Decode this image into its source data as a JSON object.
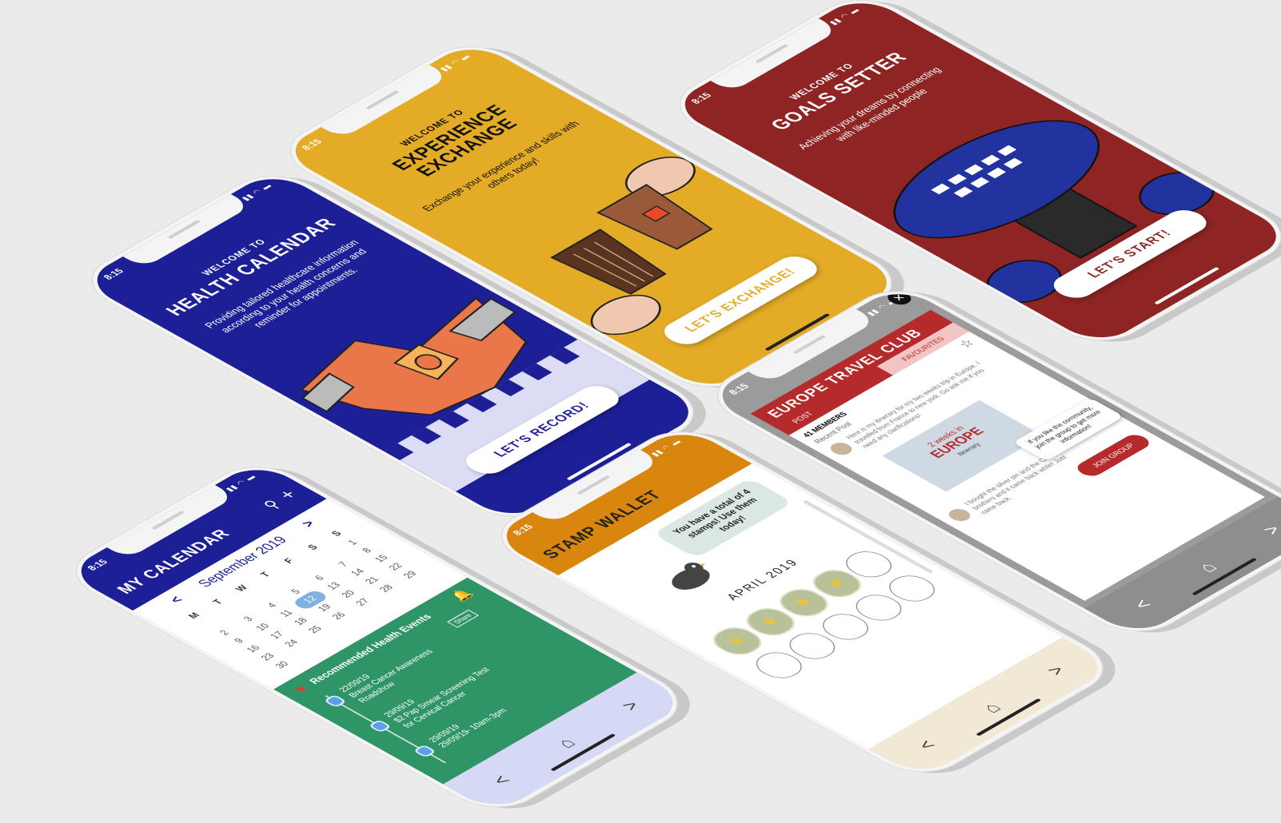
{
  "status": {
    "time": "8:15",
    "icons": "▮▮ ◠ ▬"
  },
  "phones": {
    "health": {
      "welcome_small": "WELCOME TO",
      "welcome_big": "HEALTH CALENDAR",
      "subtitle": "Providing tailored healthcare information according to your health concerns and reminder for appointments.",
      "cta": "LET'S RECORD!",
      "bg": "#1c1f96"
    },
    "experience": {
      "welcome_small": "WELCOME TO",
      "welcome_big_1": "EXPERIENCE",
      "welcome_big_2": "EXCHANGE",
      "subtitle": "Exchange your experience and skills with others today!",
      "cta": "LET'S EXCHANGE!",
      "bg": "#e3ab26"
    },
    "goals": {
      "welcome_small": "WELCOME TO",
      "welcome_big": "GOALS SETTER",
      "subtitle": "Achieving your dreams by connecting with like-minded people",
      "cta": "LET'S START!",
      "bg": "#8e2424"
    },
    "calendar": {
      "title": "MY CALENDAR",
      "month": "September 2019",
      "weekdays": [
        "M",
        "T",
        "W",
        "T",
        "F",
        "S",
        "S"
      ],
      "days": [
        "",
        "",
        "",
        "",
        "",
        "",
        "1",
        "2",
        "3",
        "4",
        "5",
        "6",
        "7",
        "8",
        "9",
        "10",
        "11",
        "12",
        "13",
        "14",
        "15",
        "16",
        "17",
        "18",
        "19",
        "20",
        "21",
        "22",
        "23",
        "24",
        "25",
        "26",
        "27",
        "28",
        "29",
        "30"
      ],
      "today": "12",
      "section_title": "Recommended Health Events",
      "share_label": "Share",
      "events": [
        {
          "date": "22/09/19",
          "title": "Breast Cancer Awareness",
          "sub": "Roadshow"
        },
        {
          "date": "29/09/19",
          "title": "$2 Pap Smear Screening Test",
          "sub": "for Cervical Cancer"
        },
        {
          "date": "29/09/19",
          "title": "29/09/19- 10am-3pm",
          "sub": ""
        }
      ],
      "header_bg": "#1c1f96",
      "events_bg": "#2f9566"
    },
    "stamp": {
      "title": "STAMP WALLET",
      "bubble": "You have a total of 4 stamps! Use them today!",
      "month": "APRIL 2019",
      "header_bg": "#d9860f"
    },
    "travel": {
      "title": "EUROPE TRAVEL CLUB",
      "tab_post": "POST",
      "tab_fav": "FAVOURITES",
      "members": "41  MEMBERS",
      "recent": "Recent Post",
      "post_text": "Here is my itinerary for my two weeks trip in Europe. I travelled from France to new york. Go ask me if you need any clarifications!",
      "card_title": "2 weeks in",
      "card_big": "EUROPE",
      "card_sub": "Itinerary",
      "comment": "I bought the silver pin and the Chan brothers and it came back while! Just came back.",
      "tooltip": "If you like the community, join the group to get more information!",
      "join": "JOIN GROUP",
      "close": "✕",
      "header_bg": "#b52a2a"
    }
  },
  "icons": {
    "back": "chevron-left-icon",
    "home": "home-icon",
    "forward": "chevron-right-icon",
    "search": "search-icon",
    "add": "plus-icon",
    "star": "star-icon",
    "bell": "bell-icon",
    "flag": "flag-icon"
  }
}
